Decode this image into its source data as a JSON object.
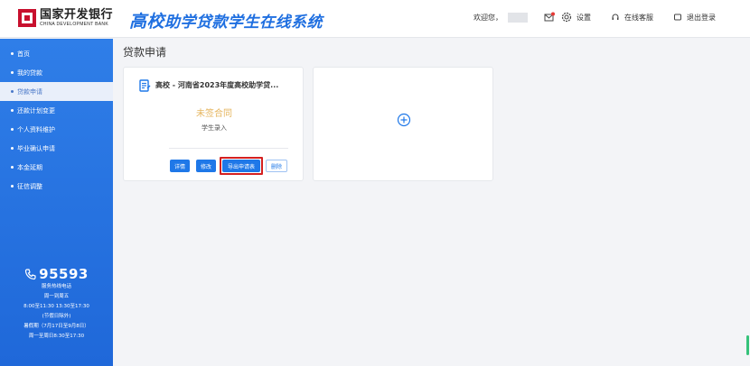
{
  "header": {
    "bank_name_cn": "国家开发银行",
    "bank_name_en": "CHINA DEVELOPMENT BANK",
    "system_title_part1": "高校",
    "system_title_part2": "助学贷款学生在线系统",
    "welcome": "欢迎您，",
    "settings_label": "设置",
    "service_label": "在线客服",
    "logout_label": "退出登录"
  },
  "sidebar": {
    "items": [
      {
        "label": "首页"
      },
      {
        "label": "我的贷款"
      },
      {
        "label": "贷款申请"
      },
      {
        "label": "还款计划变更"
      },
      {
        "label": "个人资料维护"
      },
      {
        "label": "毕业确认申请"
      },
      {
        "label": "本金延期"
      },
      {
        "label": "征信调整"
      }
    ],
    "active_index": 2,
    "hotline": {
      "number": "95593",
      "lines": [
        "服务热线电话",
        "周一到周五",
        "8:00至11:30 13:30至17:30",
        "(节假日除外)",
        "暑假期（7月17日至9月8日）",
        "周一至周日8:30至17:30"
      ]
    }
  },
  "main": {
    "page_title": "贷款申请",
    "cards": [
      {
        "title": "高校 - 河南省2023年度高校助学贷...",
        "status": "未签合同",
        "subtitle": "学生录入",
        "buttons": {
          "detail": "详情",
          "edit": "修改",
          "export": "导出申请表",
          "delete": "删除"
        }
      }
    ]
  },
  "colors": {
    "brand_blue": "#1f78e8",
    "sidebar_blue": "#2f7ee8",
    "status_orange": "#e5b45c",
    "highlight_red": "#d42020",
    "bank_red": "#c8102e"
  },
  "icons": [
    "bank-logo-icon",
    "mail-icon",
    "gear-icon",
    "headset-icon",
    "logout-icon",
    "phone-icon",
    "document-icon",
    "plus-circle-icon"
  ]
}
